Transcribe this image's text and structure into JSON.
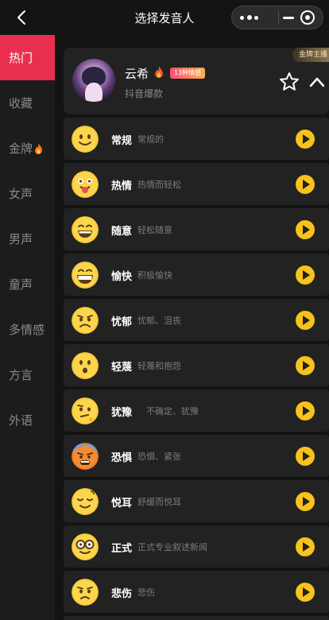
{
  "header": {
    "title": "选择发音人",
    "back_icon": "chevron-left-icon",
    "more_icon": "more-dots-icon",
    "minimize_icon": "minimize-icon",
    "target_icon": "record-target-icon"
  },
  "sidebar": {
    "items": [
      {
        "label": "热门",
        "active": true
      },
      {
        "label": "收藏",
        "active": false
      },
      {
        "label": "金牌",
        "active": false,
        "icon": "fire-icon"
      },
      {
        "label": "女声",
        "active": false
      },
      {
        "label": "男声",
        "active": false
      },
      {
        "label": "童声",
        "active": false
      },
      {
        "label": "多情感",
        "active": false
      },
      {
        "label": "方言",
        "active": false
      },
      {
        "label": "外语",
        "active": false
      }
    ]
  },
  "featured": {
    "name": "云希",
    "badge": "13种情感",
    "subtitle": "抖音爆款",
    "tag": "金牌主播",
    "star_icon": "star-outline-icon",
    "collapse_icon": "chevron-up-icon"
  },
  "emotions": [
    {
      "name": "常规",
      "desc": "常规的"
    },
    {
      "name": "热情",
      "desc": "热情而轻松"
    },
    {
      "name": "随意",
      "desc": "轻松随意"
    },
    {
      "name": "愉快",
      "desc": "积极愉快"
    },
    {
      "name": "忧郁",
      "desc": "忧郁、沮丧"
    },
    {
      "name": "轻蔑",
      "desc": "轻蔑和抱怨"
    },
    {
      "name": "犹豫",
      "desc": "不确定、犹豫"
    },
    {
      "name": "恐惧",
      "desc": "恐惧、紧张"
    },
    {
      "name": "悦耳",
      "desc": "舒缓而悦耳"
    },
    {
      "name": "正式",
      "desc": "正式专业叙述新闻"
    },
    {
      "name": "悲伤",
      "desc": "悲伤"
    }
  ],
  "colors": {
    "accent": "#e8304e",
    "play": "#f6c21c",
    "card": "#222222",
    "background": "#141414"
  }
}
